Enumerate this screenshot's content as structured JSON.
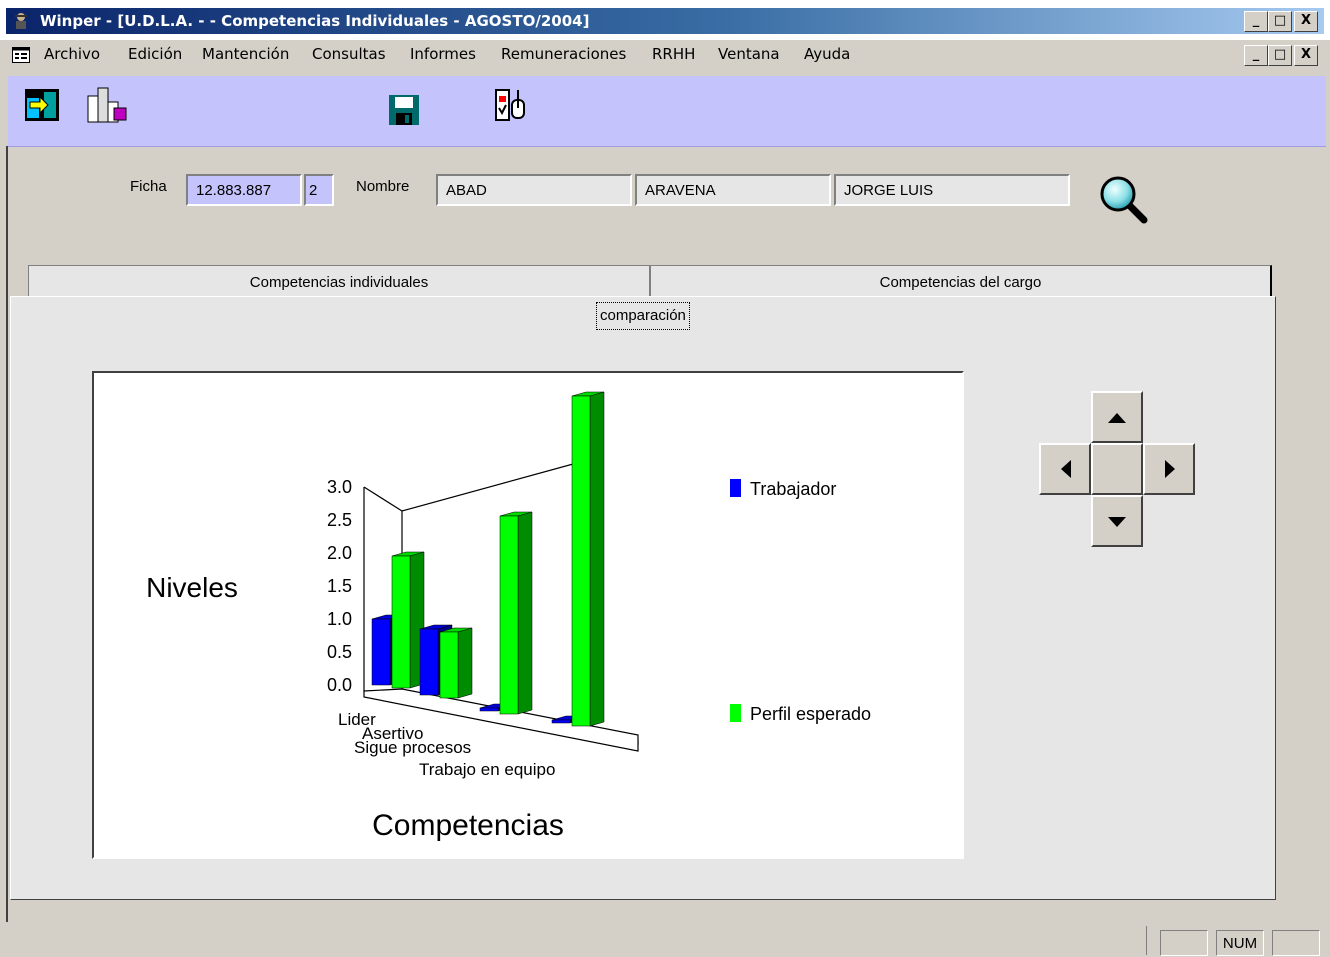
{
  "window": {
    "title": "Winper - [U.D.L.A. -  - Competencias Individuales - AGOSTO/2004]",
    "controls": [
      "_",
      "□",
      "X"
    ]
  },
  "menu": {
    "items": [
      "Archivo",
      "Edición",
      "Mantención",
      "Consultas",
      "Informes",
      "Remuneraciones",
      "RRHH",
      "Ventana",
      "Ayuda"
    ]
  },
  "toolbar": {
    "icons": [
      "exit-icon",
      "reports-icon",
      "save-icon",
      "select-icon"
    ]
  },
  "form": {
    "ficha_label": "Ficha",
    "ficha_value": "12.883.887",
    "ficha_suffix": "2",
    "nombre_label": "Nombre",
    "nombre_1": "ABAD",
    "nombre_2": "ARAVENA",
    "nombre_3": "JORGE LUIS"
  },
  "tabs": [
    "Competencias individuales",
    "Competencias del cargo"
  ],
  "subtab": "comparación",
  "chart_data": {
    "type": "bar",
    "categories": [
      "Lider",
      "Asertivo",
      "Sigue procesos",
      "Trabajo en equipo"
    ],
    "series": [
      {
        "name": "Trabajador",
        "color": "#0000ff",
        "values": [
          1.0,
          1.0,
          0.0,
          0.0
        ]
      },
      {
        "name": "Perfil esperado",
        "color": "#00ff00",
        "values": [
          2.0,
          1.0,
          3.0,
          5.0
        ]
      }
    ],
    "ylabel": "Niveles",
    "xlabel": "Competencias",
    "yticks": [
      "3.0",
      "2.5",
      "2.0",
      "1.5",
      "1.0",
      "0.5",
      "0.0"
    ],
    "legend_position": "right",
    "style": "3d"
  },
  "nav_arrows": [
    "up",
    "left",
    "right",
    "down"
  ],
  "status": {
    "num": "NUM"
  }
}
